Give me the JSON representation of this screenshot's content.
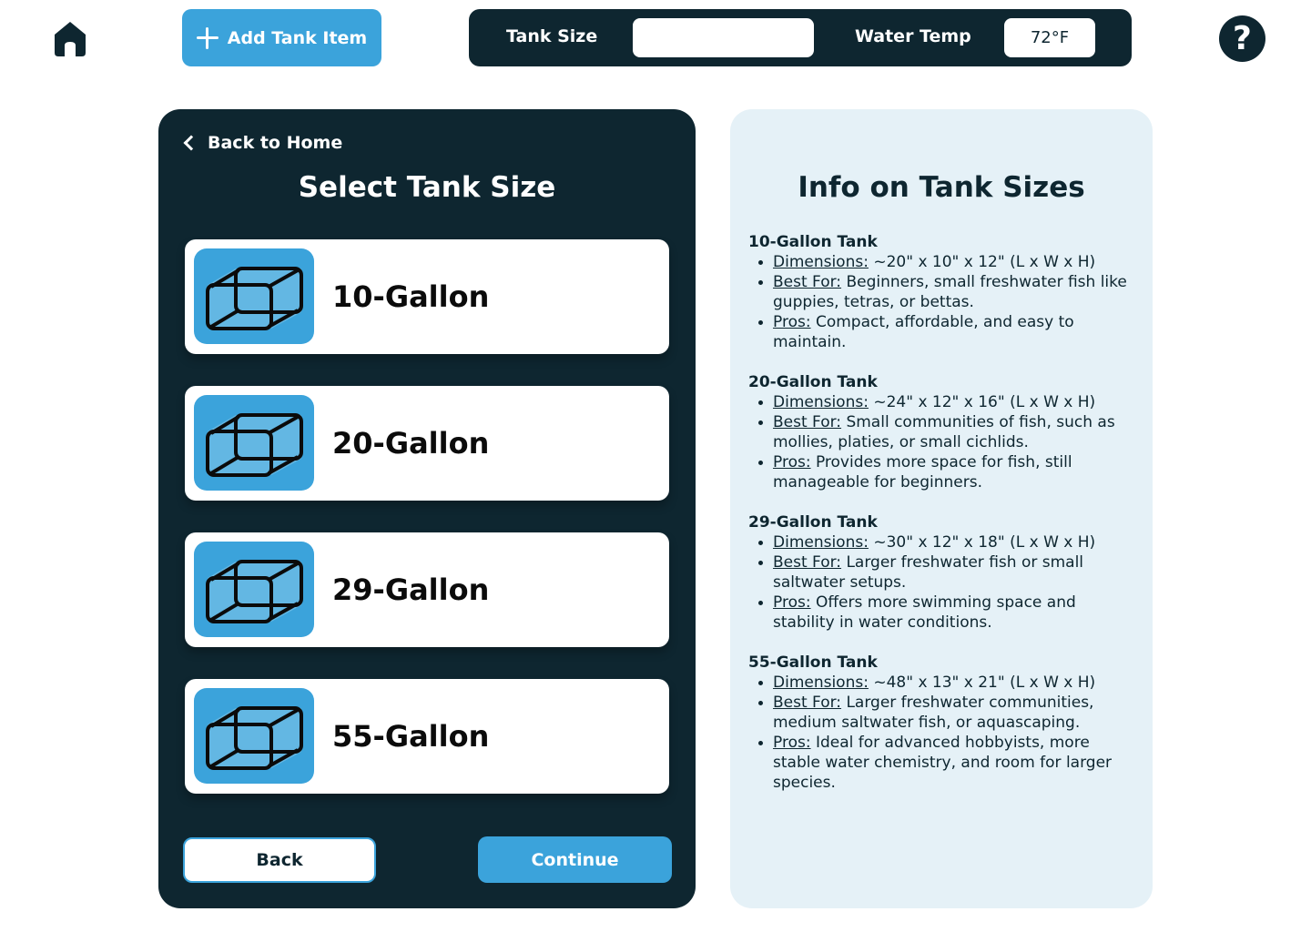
{
  "topbar": {
    "add_item_label": "Add Tank Item",
    "tank_size_label": "Tank Size",
    "tank_size_value": "",
    "water_temp_label": "Water Temp",
    "water_temp_value": "72°F",
    "help_label": "?"
  },
  "left_panel": {
    "back_link": "Back to Home",
    "title": "Select Tank Size",
    "tanks": [
      {
        "label": "10-Gallon"
      },
      {
        "label": "20-Gallon"
      },
      {
        "label": "29-Gallon"
      },
      {
        "label": "55-Gallon"
      }
    ],
    "back_button": "Back",
    "continue_button": "Continue"
  },
  "info_panel": {
    "title": "Info on Tank Sizes",
    "sections": [
      {
        "heading": "10-Gallon Tank",
        "items": [
          {
            "key": "Dimensions:",
            "text": " ~20\" x 10\" x 12\" (L x W x H)"
          },
          {
            "key": "Best For:",
            "text": " Beginners, small freshwater fish like guppies, tetras, or bettas."
          },
          {
            "key": "Pros:",
            "text": " Compact, affordable, and easy to maintain."
          }
        ]
      },
      {
        "heading": "20-Gallon Tank",
        "items": [
          {
            "key": "Dimensions:",
            "text": " ~24\" x 12\" x 16\" (L x W x H)"
          },
          {
            "key": "Best For:",
            "text": " Small communities of fish, such as mollies, platies, or small cichlids."
          },
          {
            "key": "Pros:",
            "text": " Provides more space for fish, still manageable for beginners."
          }
        ]
      },
      {
        "heading": "29-Gallon Tank",
        "items": [
          {
            "key": "Dimensions:",
            "text": " ~30\" x 12\" x 18\" (L x W x H)"
          },
          {
            "key": "Best For:",
            "text": " Larger freshwater fish or small saltwater setups."
          },
          {
            "key": "Pros:",
            "text": " Offers more swimming space and stability in water conditions."
          }
        ]
      },
      {
        "heading": "55-Gallon Tank",
        "items": [
          {
            "key": "Dimensions:",
            "text": " ~48\" x 13\" x 21\" (L x W x H)"
          },
          {
            "key": "Best For:",
            "text": " Larger freshwater communities, medium saltwater fish, or aquascaping."
          },
          {
            "key": "Pros:",
            "text": " Ideal for advanced hobbyists, more stable water chemistry, and room for larger species."
          }
        ]
      }
    ]
  },
  "colors": {
    "dark_navy": "#0e2630",
    "accent_blue": "#3ba3db",
    "info_bg": "#e5f1f7"
  },
  "icons": {
    "home": "home-icon",
    "plus": "plus-icon",
    "help": "help-icon",
    "back": "chevron-left-icon",
    "tank": "tank-icon"
  }
}
